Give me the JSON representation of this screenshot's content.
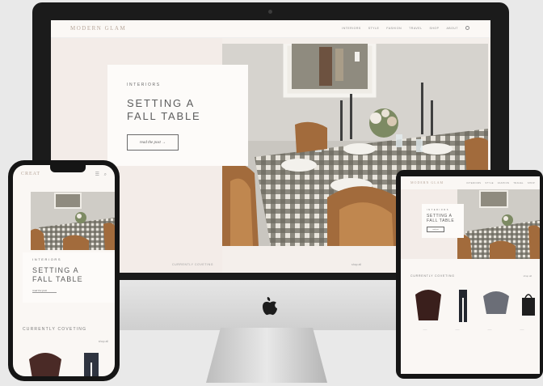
{
  "desktop": {
    "logo": "MODERN GLAM",
    "nav": [
      "INTERIORS",
      "STYLE",
      "FASHION",
      "TRAVEL",
      "SHOP",
      "ABOUT"
    ],
    "card": {
      "kicker": "INTERIORS",
      "title": "SETTING A FALL TABLE",
      "button": "read the post →"
    },
    "footer_text": "CURRENTLY COVETING",
    "footer_sig": "shop all"
  },
  "phone": {
    "logo": "CREAT",
    "icons": "☰ ⌕",
    "card": {
      "kicker": "INTERIORS",
      "title": "SETTING A FALL TABLE",
      "button": "read the post"
    },
    "section": "CURRENTLY COVETING",
    "shop_all": "shop all"
  },
  "tablet": {
    "logo": "MODERN GLAM",
    "nav": [
      "INTERIORS",
      "STYLE",
      "FASHION",
      "TRAVEL",
      "SHOP"
    ],
    "card": {
      "kicker": "INTERIORS",
      "title": "SETTING A FALL TABLE",
      "button": "read post"
    },
    "section": "CURRENTLY COVETING",
    "shop_all": "shop all",
    "captions": [
      "——",
      "——",
      "——",
      "——"
    ]
  },
  "colors": {
    "bezel": "#1b1b1b",
    "screen_bg": "#f4efeb",
    "card_bg": "#fdfbf9",
    "gingham": "#4a4a42",
    "chair": "#a26b3c"
  }
}
